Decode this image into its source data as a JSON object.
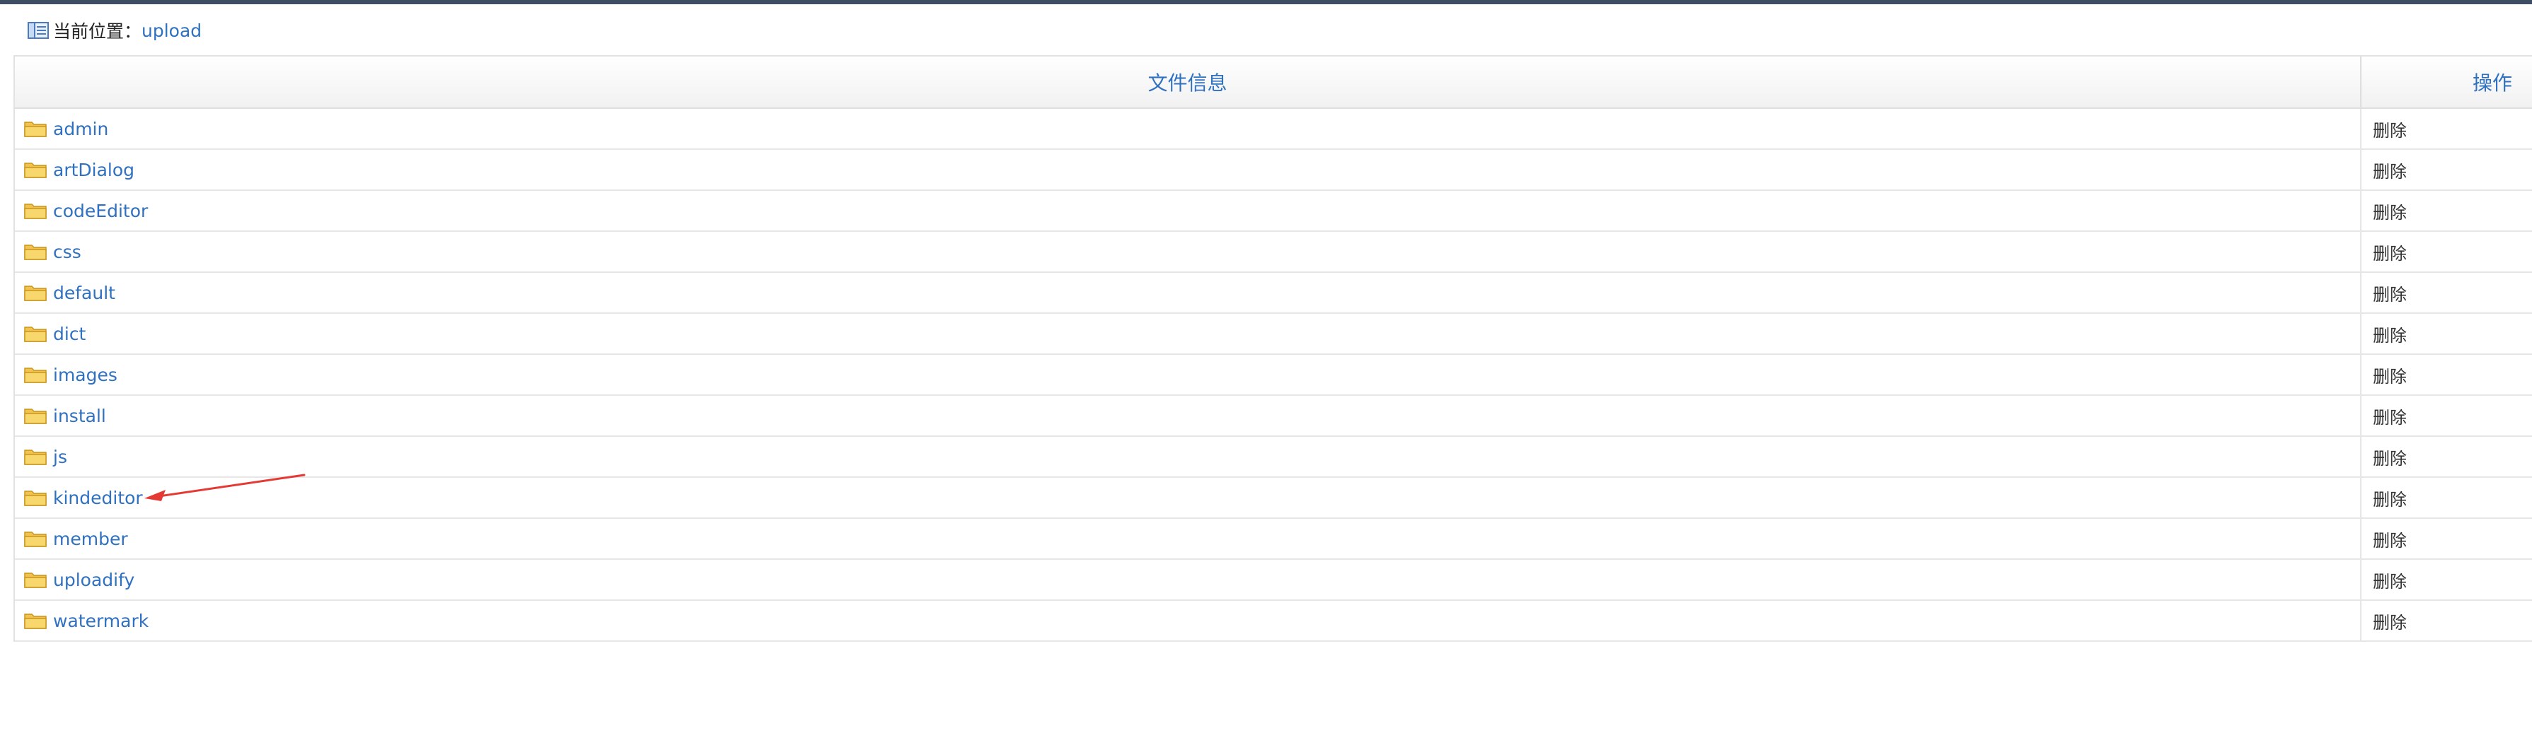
{
  "breadcrumb": {
    "prefix": "当前位置：",
    "current": "upload"
  },
  "table": {
    "header_name": "文件信息",
    "header_op": "操作",
    "rows": [
      {
        "name": "admin",
        "action": "删除"
      },
      {
        "name": "artDialog",
        "action": "删除"
      },
      {
        "name": "codeEditor",
        "action": "删除"
      },
      {
        "name": "css",
        "action": "删除"
      },
      {
        "name": "default",
        "action": "删除"
      },
      {
        "name": "dict",
        "action": "删除"
      },
      {
        "name": "images",
        "action": "删除"
      },
      {
        "name": "install",
        "action": "删除"
      },
      {
        "name": "js",
        "action": "删除"
      },
      {
        "name": "kindeditor",
        "action": "删除"
      },
      {
        "name": "member",
        "action": "删除"
      },
      {
        "name": "uploadify",
        "action": "删除"
      },
      {
        "name": "watermark",
        "action": "删除"
      }
    ]
  },
  "colors": {
    "link": "#2f71c0",
    "topbar": "#3e4d63",
    "annotation_arrow": "#e53935"
  },
  "icons": {
    "breadcrumb": "panel-icon",
    "row": "folder-icon"
  }
}
